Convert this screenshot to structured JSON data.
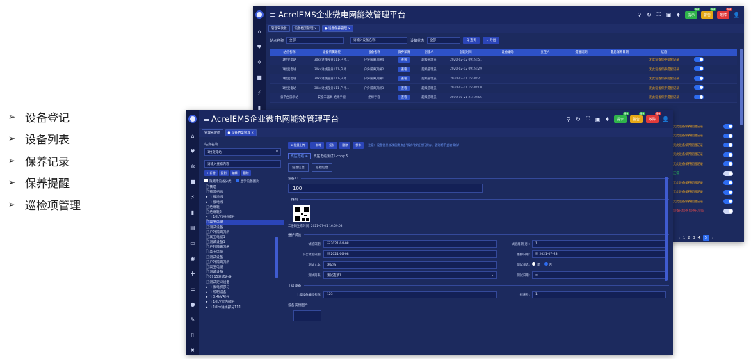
{
  "features": [
    "设备登记",
    "设备列表",
    "保养记录",
    "保养提醒",
    "巡检项管理"
  ],
  "window1": {
    "title": "AcrelEMS企业微电网能效管理平台",
    "tabs": [
      "管理驾驶舱",
      "设备档案管理 ×",
      "● 设备保养管理 ×"
    ],
    "filter": {
      "site_label": "站点名称",
      "site_value": "全部",
      "device_placeholder": "请输入设备名称",
      "status_label": "设备状态",
      "status_value": "全部",
      "query": "Q 查询",
      "export": "↓ 导出"
    },
    "columns": [
      "站点名称",
      "设备所属路径",
      "设备名称",
      "保养详情",
      "创建人",
      "创建时间",
      "设备编码",
      "责任人",
      "提醒周期",
      "最后保养日期",
      "状态"
    ],
    "rows": [
      [
        "1楼变电站",
        "30kv进线部分111-户外...",
        "户外隔离刀闸4",
        "查看",
        "超级管理员",
        "2020-02-12 09:24:51",
        "",
        "",
        "",
        "",
        "无此设备保养提醒记录"
      ],
      [
        "1楼变电站",
        "30kv进线部分111-户外...",
        "户外隔离刀闸2",
        "查看",
        "超级管理员",
        "2020-02-12 09:24:29",
        "",
        "",
        "",
        "",
        "无此设备保养提醒记录"
      ],
      [
        "1楼变电站",
        "30kv进线部分111-户外...",
        "户外隔离刀闸1",
        "查看",
        "超级管理员",
        "2020-02-11 15:48:21",
        "",
        "",
        "",
        "",
        "无此设备保养提醒记录"
      ],
      [
        "1楼变电站",
        "30kv进线部分111-户外...",
        "户外隔离刀闸3",
        "查看",
        "超级管理员",
        "2020-02-11 15:48:10",
        "",
        "",
        "",
        "",
        "无此设备保养提醒记录"
      ],
      [
        "云平台演示站",
        "安全工器具-绝缘手套",
        "绝缘手套",
        "查看",
        "超级管理员",
        "2019-10-21 21:10:55",
        "",
        "",
        "",
        "",
        "无此设备保养提醒记录"
      ]
    ],
    "side_status": [
      {
        "text": "无此设备保养提醒记录",
        "kind": "warn"
      },
      {
        "text": "无此设备保养提醒记录",
        "kind": "warn"
      },
      {
        "text": "无此设备保养提醒记录",
        "kind": "warn"
      },
      {
        "text": "无此设备保养提醒记录",
        "kind": "warn"
      },
      {
        "text": "无此设备保养提醒记录",
        "kind": "warn"
      },
      {
        "text": "正常",
        "kind": "ok"
      },
      {
        "text": "无此设备保养提醒记录",
        "kind": "warn"
      },
      {
        "text": "无此设备保养提醒记录",
        "kind": "warn"
      },
      {
        "text": "无此设备保养提醒记录",
        "kind": "warn"
      },
      {
        "text": "设备已保养 保养已完成",
        "kind": "bad"
      }
    ],
    "pages": [
      "‹",
      "1",
      "2",
      "3",
      "4",
      "5",
      "›"
    ],
    "current_page": "5"
  },
  "window2": {
    "title": "AcrelEMS企业微电网能效管理平台",
    "tabs": [
      "管理驾驶舱",
      "● 设备档案管理 ×"
    ],
    "tree": {
      "site_label": "站点名称",
      "site_value": "1楼变电站",
      "search_placeholder": "请输入搜索内容",
      "buttons": [
        "+ 新增",
        "复制",
        "编辑",
        "删除"
      ],
      "chk_hide": "隐藏无设备分类",
      "chk_show": "显示设备图片",
      "items": [
        {
          "text": "🗋 铁塔",
          "sel": false
        },
        {
          "text": "🗋 物流挡板",
          "sel": false
        },
        {
          "text": "▸ 🗀 接地线",
          "sel": false
        },
        {
          "text": "▸ 🗀 接地线",
          "sel": false
        },
        {
          "text": "🗋 绝缘靴",
          "sel": false
        },
        {
          "text": "🗋 绝缘靴2",
          "sel": false
        },
        {
          "text": "▾ 🗀 10kV进线部分",
          "sel": false
        },
        {
          "text": "🗋 高压电缆",
          "sel": true
        },
        {
          "text": "🗋 测试设备",
          "sel": false
        },
        {
          "text": "🗋 户外隔离刀闸",
          "sel": false
        },
        {
          "text": "🗋 高压电缆1",
          "sel": false
        },
        {
          "text": "🗋 测试设备1",
          "sel": false
        },
        {
          "text": "🗋 户外隔离刀闸",
          "sel": false
        },
        {
          "text": "🗋 高压电缆",
          "sel": false
        },
        {
          "text": "🗋 测试设备",
          "sel": false
        },
        {
          "text": "🗋 户外隔离刀闸",
          "sel": false
        },
        {
          "text": "🗋 高压电缆",
          "sel": false
        },
        {
          "text": "🗋 测试设备",
          "sel": false
        },
        {
          "text": "🗋 0915测试设备",
          "sel": false
        },
        {
          "text": "🗋 测试定义设备",
          "sel": false
        },
        {
          "text": "▸ 🗀 发电机部分",
          "sel": false
        },
        {
          "text": "▸ 🗀 照明设备",
          "sel": false
        },
        {
          "text": "▸ 🗀 0.4kV部分",
          "sel": false
        },
        {
          "text": "▸ 🗀 10kV室内部分",
          "sel": false
        },
        {
          "text": "▸ 🗀 10kv进线部分111",
          "sel": false
        }
      ]
    },
    "form": {
      "toolbar": [
        "⊕ 批量上传",
        "+ 新增",
        "复制",
        "删除",
        "保存"
      ],
      "note": "注意：设备信息修改后需点击\"保存\"按钮进行保存，否则将不会被保存!",
      "breadcrumb_prev": "高压电缆 ⊗",
      "breadcrumb_cur": "高压电缆测试1-copy 5",
      "subtabs": [
        "设备信息",
        "巡检信息"
      ],
      "sec_id": "设备ID",
      "device_id": "100",
      "sec_qr": "二维码",
      "qr_time": "二维码生成时间: 2021-07-01 16:59:03",
      "sec_maint": "维护试验",
      "fields": [
        {
          "k": "试验日期:",
          "v": "☷ 2021-04-08",
          "k2": "试验周期(月):",
          "v2": "1"
        },
        {
          "k": "下次试验日期:",
          "v": "☷ 2021-06-08",
          "k2": "维护日期:",
          "v2": "☷ 2021-07-23"
        },
        {
          "k": "测试文本:",
          "v": "测试数",
          "k2": "测试单选:",
          "radio": [
            "是",
            "否"
          ]
        },
        {
          "k": "测试列表:",
          "v": "测试选项1",
          "k2": "测试日期:",
          "v2": "☷"
        }
      ],
      "sec_upper": "上级设备",
      "upper_label": "上级设备编号名称:",
      "upper_value": "123",
      "sort_label": "排序号:",
      "sort_value": "1",
      "sec_image": "设备实物图片"
    }
  }
}
